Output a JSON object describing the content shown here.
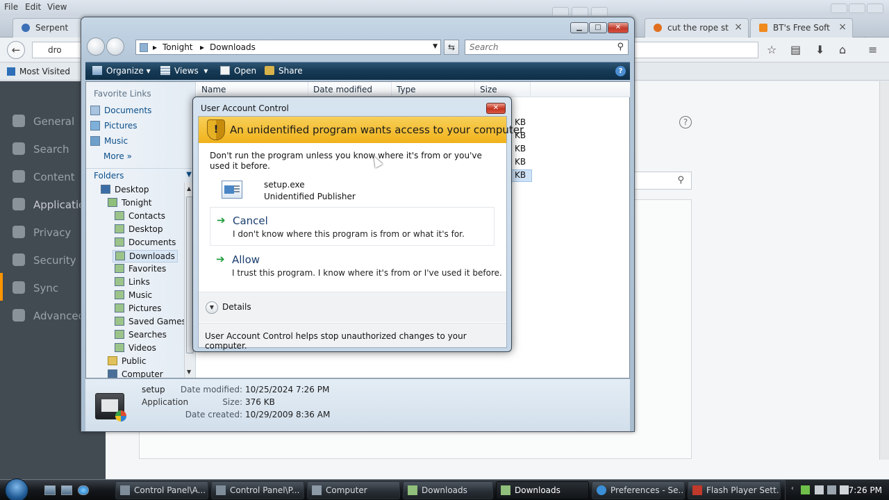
{
  "browser": {
    "menu": [
      "File",
      "Edit",
      "View"
    ],
    "tabs": [
      {
        "label": "Serpent",
        "color": "#3b6fb6"
      },
      {
        "label": "cut the rope st",
        "color": "#e0701f"
      },
      {
        "label": "BT's Free Soft",
        "color": "#f08a1c"
      }
    ],
    "new_tab_glyph": "+",
    "url_partial": "dro",
    "bookmarks_label": "Most Visited",
    "sidebar_categories": [
      "General",
      "Search",
      "Content",
      "Applications",
      "Privacy",
      "Security",
      "Sync",
      "Advanced"
    ],
    "active_category_index": 3
  },
  "explorer": {
    "breadcrumb": [
      "Tonight",
      "Downloads"
    ],
    "search_placeholder": "Search",
    "toolbar": {
      "organize": "Organize",
      "views": "Views",
      "open": "Open",
      "share": "Share"
    },
    "favorite_links_title": "Favorite Links",
    "favorites": [
      "Documents",
      "Pictures",
      "Music",
      "More"
    ],
    "folders_title": "Folders",
    "tree": [
      {
        "label": "Desktop",
        "level": 0
      },
      {
        "label": "Tonight",
        "level": 1
      },
      {
        "label": "Contacts",
        "level": 2
      },
      {
        "label": "Desktop",
        "level": 2
      },
      {
        "label": "Documents",
        "level": 2
      },
      {
        "label": "Downloads",
        "level": 2,
        "selected": true
      },
      {
        "label": "Favorites",
        "level": 2
      },
      {
        "label": "Links",
        "level": 2
      },
      {
        "label": "Music",
        "level": 2
      },
      {
        "label": "Pictures",
        "level": 2
      },
      {
        "label": "Saved Games",
        "level": 2
      },
      {
        "label": "Searches",
        "level": 2
      },
      {
        "label": "Videos",
        "level": 2
      },
      {
        "label": "Public",
        "level": 1
      },
      {
        "label": "Computer",
        "level": 1
      }
    ],
    "columns": [
      "Name",
      "Date modified",
      "Type",
      "Size"
    ],
    "size_cells": [
      "KB",
      "KB",
      "KB",
      "KB",
      "KB"
    ],
    "details": {
      "name": "setup",
      "kind": "Application",
      "date_modified_label": "Date modified:",
      "date_modified": "10/25/2024 7:26 PM",
      "size_label": "Size:",
      "size": "376 KB",
      "date_created_label": "Date created:",
      "date_created": "10/29/2009 8:36 AM"
    }
  },
  "uac": {
    "title": "User Account Control",
    "heading": "An unidentified program wants access to your computer",
    "warning": "Don't run the program unless you know where it's from or you've used it before.",
    "program_name": "setup.exe",
    "publisher": "Unidentified Publisher",
    "cancel_label": "Cancel",
    "cancel_desc": "I don't know where this program is from or what it's for.",
    "allow_label": "Allow",
    "allow_desc": "I trust this program. I know where it's from or I've used it before.",
    "details_label": "Details",
    "footer": "User Account Control helps stop unauthorized changes to your computer."
  },
  "taskbar": {
    "buttons": [
      {
        "label": "Control Panel\\A...",
        "active": false
      },
      {
        "label": "Control Panel\\P...",
        "active": false
      },
      {
        "label": "Computer",
        "active": false
      },
      {
        "label": "Downloads",
        "active": false
      },
      {
        "label": "Downloads",
        "active": true
      },
      {
        "label": "Preferences - Se...",
        "active": false
      },
      {
        "label": "Flash Player Sett...",
        "active": false
      }
    ],
    "time": "7:26 PM"
  },
  "colors": {
    "uac_banner": "#f0b21b",
    "explorer_toolbar": "#163a55",
    "firefox_active": "#ff9500",
    "link_blue": "#0b4e8a"
  }
}
